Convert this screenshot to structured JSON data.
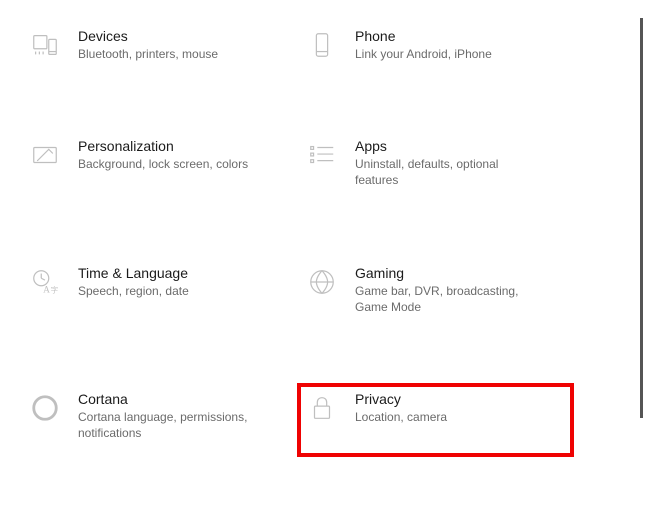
{
  "tiles": [
    {
      "title": "Devices",
      "subtitle": "Bluetooth, printers, mouse"
    },
    {
      "title": "Phone",
      "subtitle": "Link your Android, iPhone"
    },
    {
      "title": "Personalization",
      "subtitle": "Background, lock screen, colors"
    },
    {
      "title": "Apps",
      "subtitle": "Uninstall, defaults, optional features"
    },
    {
      "title": "Time & Language",
      "subtitle": "Speech, region, date"
    },
    {
      "title": "Gaming",
      "subtitle": "Game bar, DVR, broadcasting, Game Mode"
    },
    {
      "title": "Cortana",
      "subtitle": "Cortana language, permissions, notifications"
    },
    {
      "title": "Privacy",
      "subtitle": "Location, camera"
    }
  ]
}
